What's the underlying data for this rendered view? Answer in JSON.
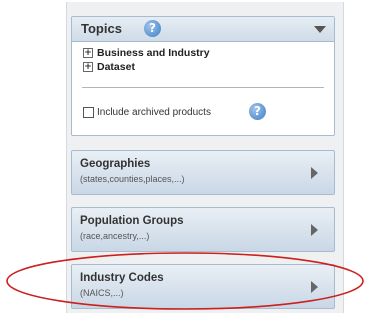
{
  "topics": {
    "title": "Topics",
    "help_glyph": "?",
    "items": [
      {
        "label": "Business and Industry"
      },
      {
        "label": "Dataset"
      }
    ],
    "archived_label": "Include archived products"
  },
  "categories": [
    {
      "title": "Geographies",
      "subtitle": "(states,counties,places,...)"
    },
    {
      "title": "Population Groups",
      "subtitle": "(race,ancestry,...)"
    },
    {
      "title": "Industry Codes",
      "subtitle": "(NAICS,...)"
    }
  ],
  "colors": {
    "panel_border": "#a9bccf",
    "header_gradient_top": "#e6edf4",
    "header_gradient_bottom": "#cfdbe7",
    "help_icon": "#3d7fc4",
    "highlight_ellipse": "#cc1f1f"
  },
  "icons": {
    "topics_help": "help-icon",
    "topics_collapse": "triangle-down-icon",
    "tree_expand": "plus-box-icon",
    "category_expand": "triangle-right-icon"
  }
}
